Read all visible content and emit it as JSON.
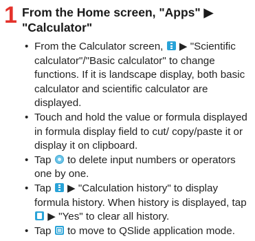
{
  "step": {
    "number": "1",
    "title": "From the Home screen, \"Apps\" ▶ \"Calculator\""
  },
  "notes": [
    {
      "a": "From the Calculator screen, ",
      "icon": "menu-icon",
      "b": " ▶ \"Scientific calculator\"/\"Basic calculator\" to change functions. If it is landscape display, both basic calculator and scientific calculator are displayed."
    },
    {
      "a": "Touch and hold the value or formula displayed in formula display field to cut/ copy/paste it or display it on clipboard."
    },
    {
      "a": "Tap ",
      "icon": "delete-icon",
      "b": " to delete input numbers or operators one by one."
    },
    {
      "a": "Tap ",
      "icon": "menu-icon",
      "b": " ▶ \"Calculation history\" to display formula history. When history is displayed, tap ",
      "icon2": "clear-history-icon",
      "c": " ▶ \"Yes\" to clear all history."
    },
    {
      "a": "Tap ",
      "icon": "qslide-icon",
      "b": " to move to QSlide application mode."
    }
  ]
}
